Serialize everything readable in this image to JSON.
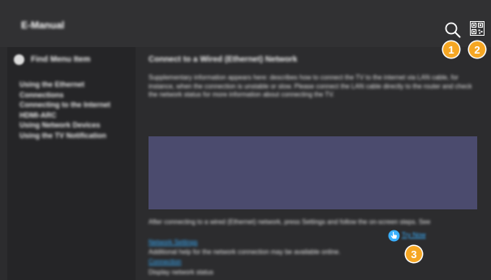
{
  "header": {
    "title": "E-Manual"
  },
  "sidebar": {
    "head_label": "Find Menu Item",
    "items": [
      "Using the Ethernet",
      "Connections",
      "Connecting to the Internet",
      "HDMI-ARC",
      "Using Network Devices",
      "Using the TV Notification"
    ]
  },
  "main": {
    "heading": "Connect to a Wired (Ethernet) Network",
    "paragraph": "Supplementary information appears here: describes how to connect the TV to the internet via LAN cable, for instance, when the connection is unstable or slow. Please connect the LAN cable directly to the router and check the network status for more information about connecting the TV.",
    "para2_start": "After connecting to a wired (Ethernet) network, press Settings and follow the on-screen steps. See",
    "inline_link": "Try Now",
    "line2": "Network Settings",
    "line3": "Additional help for the network connection may be available online.",
    "line4": "Connection",
    "line5": "Display network status"
  },
  "callouts": [
    "1",
    "2",
    "3"
  ],
  "colors": {
    "background": "#2c2c2e",
    "sidebar": "#252527",
    "image_placeholder": "#4b4b6e",
    "callout": "#f5a623",
    "link": "#3ab0ff"
  },
  "icons": {
    "search": "search-icon",
    "qr": "qr-code-icon",
    "pointer": "hand-pointer-icon",
    "home": "home-icon"
  }
}
